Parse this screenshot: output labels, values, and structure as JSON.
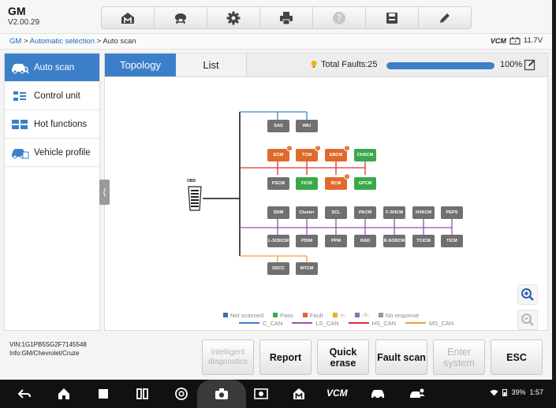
{
  "app": {
    "name": "GM",
    "version": "V2.00.29"
  },
  "toolbar": {
    "icons": [
      "home-icon",
      "vehicle-lift-icon",
      "gear-icon",
      "printer-icon",
      "help-icon",
      "save-icon",
      "edit-icon"
    ]
  },
  "breadcrumb": {
    "root": "GM",
    "sep1": " > ",
    "middle": "Automatic selection",
    "sep2": " > ",
    "current": "Auto scan"
  },
  "status": {
    "vcm": "VCM",
    "voltage": "11.7V"
  },
  "sidebar": {
    "items": [
      {
        "label": "Auto scan",
        "icon": "car-scan-icon",
        "active": true
      },
      {
        "label": "Control unit",
        "icon": "control-unit-icon",
        "active": false
      },
      {
        "label": "Hot functions",
        "icon": "hot-functions-icon",
        "active": false
      },
      {
        "label": "Vehicle profile",
        "icon": "vehicle-profile-icon",
        "active": false
      }
    ],
    "collapse": "⟨"
  },
  "tabs": {
    "topology": "Topology",
    "list": "List"
  },
  "summary": {
    "faults_label": "Total Faults:25",
    "progress": 100,
    "progress_text": "100%"
  },
  "topology": {
    "obd": "OBD",
    "modules": [
      {
        "name": "SAS",
        "status": "not-scanned"
      },
      {
        "name": "IMU",
        "status": "not-scanned"
      },
      {
        "name": "ECM",
        "status": "fault",
        "badge": "!"
      },
      {
        "name": "TCM",
        "status": "fault",
        "badge": "!"
      },
      {
        "name": "EBCM",
        "status": "fault",
        "badge": "!"
      },
      {
        "name": "CHSCM",
        "status": "pass"
      },
      {
        "name": "PSCM",
        "status": "not-scanned"
      },
      {
        "name": "FICM",
        "status": "pass"
      },
      {
        "name": "BCM",
        "status": "fault",
        "badge": "!"
      },
      {
        "name": "GPCM",
        "status": "pass"
      },
      {
        "name": "SDM",
        "status": "not-scanned"
      },
      {
        "name": "Cluster",
        "status": "not-scanned"
      },
      {
        "name": "SCL",
        "status": "not-scanned"
      },
      {
        "name": "PACM",
        "status": "not-scanned"
      },
      {
        "name": "F-SHCM",
        "status": "not-scanned"
      },
      {
        "name": "HVACM",
        "status": "not-scanned"
      },
      {
        "name": "PEPS",
        "status": "not-scanned"
      },
      {
        "name": "L-SODCM",
        "status": "not-scanned"
      },
      {
        "name": "PDIM",
        "status": "not-scanned"
      },
      {
        "name": "PPM",
        "status": "not-scanned"
      },
      {
        "name": "RAD",
        "status": "not-scanned"
      },
      {
        "name": "R-SODCM",
        "status": "not-scanned"
      },
      {
        "name": "TCICM",
        "status": "not-scanned"
      },
      {
        "name": "TICM",
        "status": "not-scanned"
      },
      {
        "name": "DSCC",
        "status": "not-scanned"
      },
      {
        "name": "MTCM",
        "status": "not-scanned"
      }
    ]
  },
  "legend": {
    "status": [
      {
        "label": "Not scanned",
        "color": "#3c6fb5"
      },
      {
        "label": "Pass",
        "color": "#3aa84a"
      },
      {
        "label": "Fault",
        "color": "#e06a2c"
      },
      {
        "label": "-!-",
        "color": "#e8b020"
      },
      {
        "label": "-?-",
        "color": "#8a6fc0"
      },
      {
        "label": "No response",
        "color": "#9a9a9a"
      }
    ],
    "buses": [
      {
        "label": "C_CAN",
        "color": "#3c7fc9"
      },
      {
        "label": "LS_CAN",
        "color": "#9b4fb5"
      },
      {
        "label": "HS_CAN",
        "color": "#e03030"
      },
      {
        "label": "MS_CAN",
        "color": "#f0a030"
      }
    ]
  },
  "vehicle": {
    "vin": "VIN:1G1PB5SG2F7145548",
    "info": "Info:GM/Chevrolet/Cruze"
  },
  "actions": {
    "intelligent": "Intelligent diagnostics",
    "report": "Report",
    "quick_erase": "Quick erase",
    "fault_scan": "Fault scan",
    "enter_system": "Enter system",
    "esc": "ESC"
  },
  "navbar": {
    "battery": "39%",
    "time": "1:57",
    "vcm": "VCM"
  },
  "colors": {
    "accent": "#3c7fc9",
    "fault": "#e06a2c",
    "pass": "#3aa84a",
    "not_scanned": "#707070"
  }
}
